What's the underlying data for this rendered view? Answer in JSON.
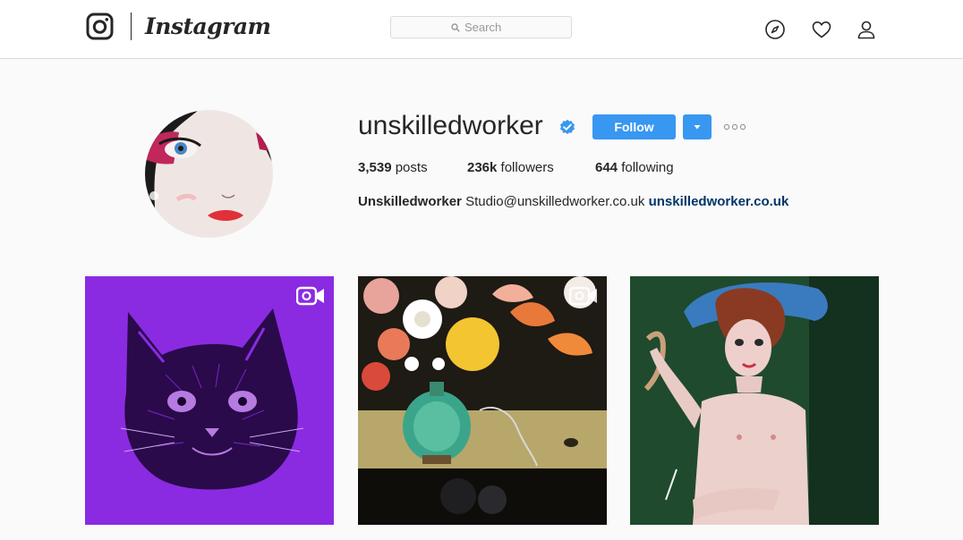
{
  "header": {
    "brand": "Instagram",
    "search": {
      "placeholder": "Search",
      "value": ""
    },
    "icons": [
      "instagram-camera-icon",
      "search-icon",
      "compass-icon",
      "heart-icon",
      "person-icon"
    ]
  },
  "profile": {
    "username": "unskilledworker",
    "verified": true,
    "follow_label": "Follow",
    "stats": {
      "posts_count": "3,539",
      "posts_label": "posts",
      "followers_count": "236k",
      "followers_label": "followers",
      "following_count": "644",
      "following_label": "following"
    },
    "bio": {
      "name": "Unskilledworker",
      "text": "Studio@unskilledworker.co.uk",
      "link": "unskilledworker.co.uk"
    }
  },
  "posts": [
    {
      "kind": "video",
      "subject": "purple cat illustration",
      "bg": "#8a2be2"
    },
    {
      "kind": "video",
      "subject": "flower vase still life painting",
      "bg": "#1e1a14"
    },
    {
      "kind": "image",
      "subject": "painted woman with blue hat",
      "bg": "#1f4a2e"
    }
  ],
  "colors": {
    "accent": "#3897f0",
    "link": "#003569",
    "verified": "#3897f0",
    "background": "#fafafa"
  }
}
